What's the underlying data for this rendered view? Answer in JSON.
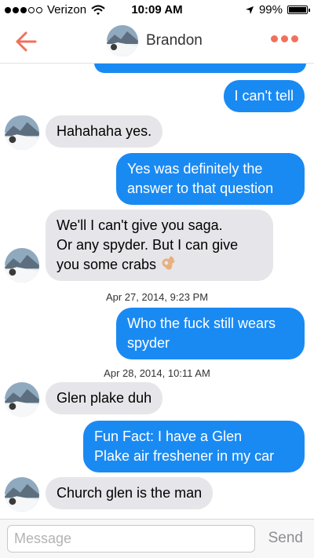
{
  "status_bar": {
    "carrier": "Verizon",
    "time": "10:09 AM",
    "battery": "99%",
    "battery_level": 0.99,
    "signal_bars": 3,
    "signal_total": 5
  },
  "nav": {
    "title": "Brandon",
    "accent_color": "#f0715b"
  },
  "messages": [
    {
      "type": "out",
      "text": "I can't tell"
    },
    {
      "type": "in",
      "text": "Hahahaha yes."
    },
    {
      "type": "out",
      "lines": [
        "Yes was definitely the",
        "answer to that question"
      ]
    },
    {
      "type": "in",
      "lines": [
        "We'll I can't give you saga.",
        "Or any spyder. But I can give",
        "you some crabs"
      ],
      "emoji": "ok-hand-emoji"
    },
    {
      "type": "timestamp",
      "text": "Apr 27, 2014, 9:23 PM"
    },
    {
      "type": "out",
      "lines": [
        "Who the fuck still wears",
        "spyder"
      ]
    },
    {
      "type": "timestamp",
      "text": "Apr 28, 2014, 10:11 AM"
    },
    {
      "type": "in",
      "text": "Glen plake duh"
    },
    {
      "type": "out",
      "lines": [
        "Fun Fact: I have a Glen",
        "Plake air freshener in my car"
      ]
    },
    {
      "type": "in",
      "text": "Church glen is the man"
    }
  ],
  "input": {
    "placeholder": "Message",
    "value": "",
    "send_label": "Send"
  },
  "colors": {
    "outgoing_bubble": "#1a8af3",
    "incoming_bubble": "#e6e6ea"
  }
}
